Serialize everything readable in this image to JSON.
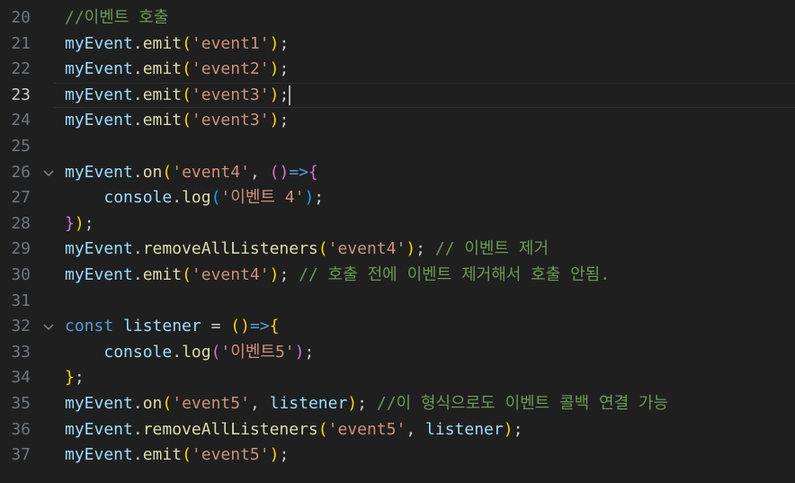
{
  "editor": {
    "colors": {
      "background": "#1f1f1f",
      "line_number": "#6e7681",
      "variable": "#9cdcfe",
      "function": "#dcdcaa",
      "string": "#ce9178",
      "comment": "#6a9955",
      "keyword": "#569cd6",
      "bracket_level1": "#ffd700",
      "bracket_level2": "#da70d6",
      "bracket_level3": "#179fff"
    },
    "current_line": "23",
    "fold_icon": "chevron-down-icon",
    "lines": [
      {
        "num": "20",
        "fold": false,
        "tokens": [
          [
            "cmt",
            "//이벤트 호출"
          ]
        ]
      },
      {
        "num": "21",
        "fold": false,
        "tokens": [
          [
            "var",
            "myEvent"
          ],
          [
            "punc",
            "."
          ],
          [
            "fn",
            "emit"
          ],
          [
            "b1",
            "("
          ],
          [
            "str",
            "'event1'"
          ],
          [
            "b1",
            ")"
          ],
          [
            "punc",
            ";"
          ]
        ]
      },
      {
        "num": "22",
        "fold": false,
        "tokens": [
          [
            "var",
            "myEvent"
          ],
          [
            "punc",
            "."
          ],
          [
            "fn",
            "emit"
          ],
          [
            "b1",
            "("
          ],
          [
            "str",
            "'event2'"
          ],
          [
            "b1",
            ")"
          ],
          [
            "punc",
            ";"
          ]
        ]
      },
      {
        "num": "23",
        "fold": false,
        "current": true,
        "tokens": [
          [
            "var",
            "myEvent"
          ],
          [
            "punc",
            "."
          ],
          [
            "fn",
            "emit"
          ],
          [
            "b1",
            "("
          ],
          [
            "str",
            "'event3'"
          ],
          [
            "b1",
            ")"
          ],
          [
            "punc",
            ";"
          ],
          [
            "cursor",
            ""
          ]
        ]
      },
      {
        "num": "24",
        "fold": false,
        "tokens": [
          [
            "var",
            "myEvent"
          ],
          [
            "punc",
            "."
          ],
          [
            "fn",
            "emit"
          ],
          [
            "b1",
            "("
          ],
          [
            "str",
            "'event3'"
          ],
          [
            "b1",
            ")"
          ],
          [
            "punc",
            ";"
          ]
        ]
      },
      {
        "num": "25",
        "fold": false,
        "tokens": []
      },
      {
        "num": "26",
        "fold": true,
        "tokens": [
          [
            "var",
            "myEvent"
          ],
          [
            "punc",
            "."
          ],
          [
            "fn",
            "on"
          ],
          [
            "b1",
            "("
          ],
          [
            "str",
            "'event4'"
          ],
          [
            "punc",
            ", "
          ],
          [
            "b2",
            "()"
          ],
          [
            "arrow",
            "=>"
          ],
          [
            "b2",
            "{"
          ]
        ]
      },
      {
        "num": "27",
        "fold": false,
        "tokens": [
          [
            "punc",
            "    "
          ],
          [
            "id",
            "console"
          ],
          [
            "punc",
            "."
          ],
          [
            "fn",
            "log"
          ],
          [
            "b3",
            "("
          ],
          [
            "str",
            "'이벤트 4'"
          ],
          [
            "b3",
            ")"
          ],
          [
            "punc",
            ";"
          ]
        ]
      },
      {
        "num": "28",
        "fold": false,
        "tokens": [
          [
            "b2",
            "}"
          ],
          [
            "b1",
            ")"
          ],
          [
            "punc",
            ";"
          ]
        ]
      },
      {
        "num": "29",
        "fold": false,
        "tokens": [
          [
            "var",
            "myEvent"
          ],
          [
            "punc",
            "."
          ],
          [
            "fn",
            "removeAllListeners"
          ],
          [
            "b1",
            "("
          ],
          [
            "str",
            "'event4'"
          ],
          [
            "b1",
            ")"
          ],
          [
            "punc",
            "; "
          ],
          [
            "cmt",
            "// 이벤트 제거"
          ]
        ]
      },
      {
        "num": "30",
        "fold": false,
        "tokens": [
          [
            "var",
            "myEvent"
          ],
          [
            "punc",
            "."
          ],
          [
            "fn",
            "emit"
          ],
          [
            "b1",
            "("
          ],
          [
            "str",
            "'event4'"
          ],
          [
            "b1",
            ")"
          ],
          [
            "punc",
            "; "
          ],
          [
            "cmt",
            "// 호출 전에 이벤트 제거해서 호출 안됨."
          ]
        ]
      },
      {
        "num": "31",
        "fold": false,
        "tokens": []
      },
      {
        "num": "32",
        "fold": true,
        "tokens": [
          [
            "kw",
            "const"
          ],
          [
            "punc",
            " "
          ],
          [
            "id",
            "listener"
          ],
          [
            "punc",
            " = "
          ],
          [
            "b1",
            "()"
          ],
          [
            "arrow",
            "=>"
          ],
          [
            "b1",
            "{"
          ]
        ]
      },
      {
        "num": "33",
        "fold": false,
        "tokens": [
          [
            "punc",
            "    "
          ],
          [
            "id",
            "console"
          ],
          [
            "punc",
            "."
          ],
          [
            "fn",
            "log"
          ],
          [
            "b2",
            "("
          ],
          [
            "str",
            "'이벤트5'"
          ],
          [
            "b2",
            ")"
          ],
          [
            "punc",
            ";"
          ]
        ]
      },
      {
        "num": "34",
        "fold": false,
        "tokens": [
          [
            "b1",
            "}"
          ],
          [
            "punc",
            ";"
          ]
        ]
      },
      {
        "num": "35",
        "fold": false,
        "tokens": [
          [
            "var",
            "myEvent"
          ],
          [
            "punc",
            "."
          ],
          [
            "fn",
            "on"
          ],
          [
            "b1",
            "("
          ],
          [
            "str",
            "'event5'"
          ],
          [
            "punc",
            ", "
          ],
          [
            "id",
            "listener"
          ],
          [
            "b1",
            ")"
          ],
          [
            "punc",
            "; "
          ],
          [
            "cmt",
            "//이 형식으로도 이벤트 콜백 연결 가능"
          ]
        ]
      },
      {
        "num": "36",
        "fold": false,
        "tokens": [
          [
            "var",
            "myEvent"
          ],
          [
            "punc",
            "."
          ],
          [
            "fn",
            "removeAllListeners"
          ],
          [
            "b1",
            "("
          ],
          [
            "str",
            "'event5'"
          ],
          [
            "punc",
            ", "
          ],
          [
            "id",
            "listener"
          ],
          [
            "b1",
            ")"
          ],
          [
            "punc",
            ";"
          ]
        ]
      },
      {
        "num": "37",
        "fold": false,
        "tokens": [
          [
            "var",
            "myEvent"
          ],
          [
            "punc",
            "."
          ],
          [
            "fn",
            "emit"
          ],
          [
            "b1",
            "("
          ],
          [
            "str",
            "'event5'"
          ],
          [
            "b1",
            ")"
          ],
          [
            "punc",
            ";"
          ]
        ]
      }
    ]
  }
}
